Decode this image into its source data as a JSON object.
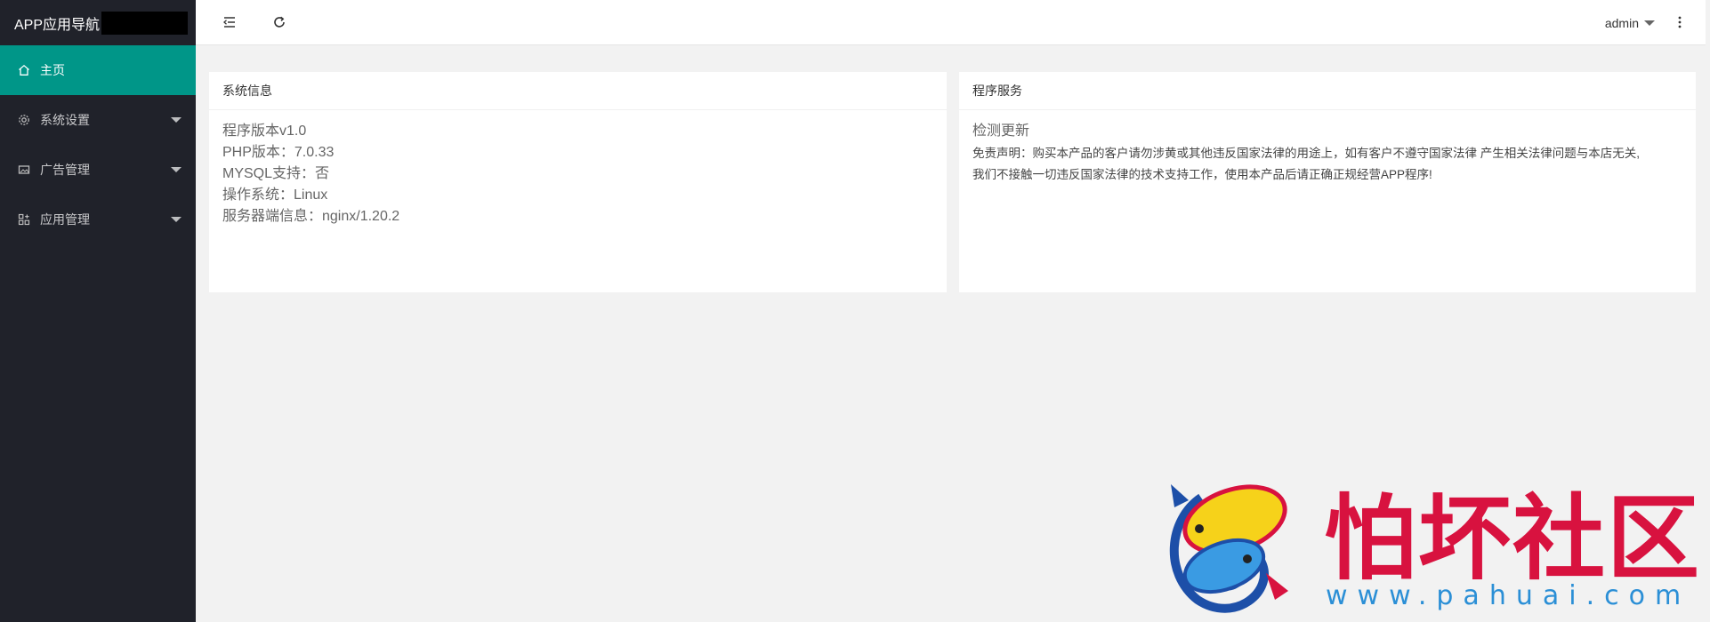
{
  "sidebar": {
    "brand": "APP应用导航",
    "items": [
      {
        "label": "主页",
        "icon": "home-icon",
        "active": true
      },
      {
        "label": "系统设置",
        "icon": "gear-icon"
      },
      {
        "label": "广告管理",
        "icon": "image-icon"
      },
      {
        "label": "应用管理",
        "icon": "apps-icon"
      }
    ]
  },
  "header": {
    "user": "admin"
  },
  "system_info": {
    "title": "系统信息",
    "lines": [
      "程序版本v1.0",
      "PHP版本：7.0.33",
      "MYSQL支持：否",
      "操作系统：Linux",
      "服务器端信息：nginx/1.20.2"
    ]
  },
  "program_service": {
    "title": "程序服务",
    "update_label": "检测更新",
    "disclaimer_1": "免责声明：购买本产品的客户请勿涉黄或其他违反国家法律的用途上，如有客户不遵守国家法律 产生相关法律问题与本店无关,",
    "disclaimer_2": "我们不接触一切违反国家法律的技术支持工作，使用本产品后请正确正规经营APP程序!"
  },
  "watermark": {
    "text": "怕坏社区",
    "url": "www.pahuai.com"
  },
  "colors": {
    "sidebar_bg": "#20222a",
    "active": "#009688",
    "watermark_red": "#d8123f",
    "watermark_blue": "#2b8fd6"
  }
}
